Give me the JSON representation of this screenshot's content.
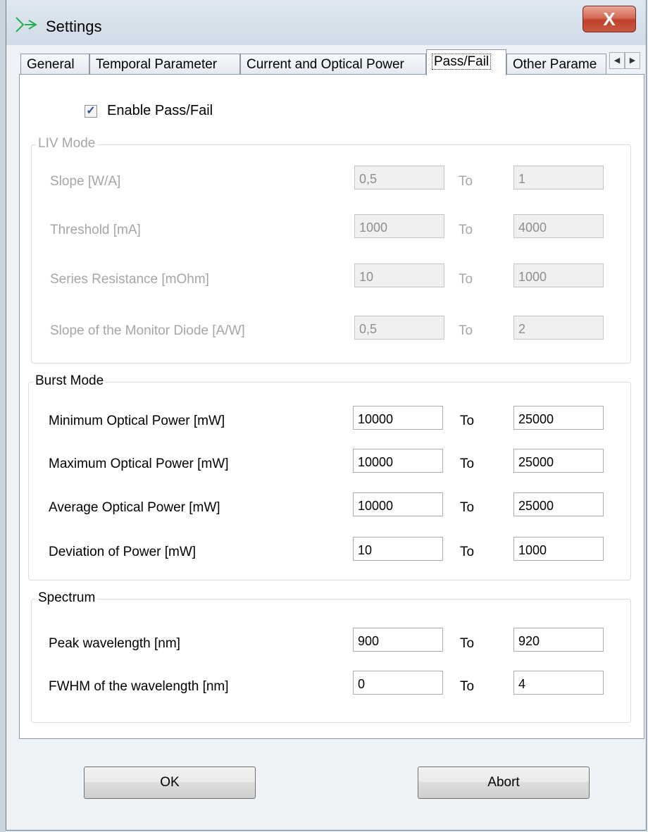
{
  "window": {
    "title": "Settings",
    "close_glyph": "X"
  },
  "icons": {
    "app": "settings-app-icon",
    "close": "close-icon",
    "scroll_left": "chevron-left-icon",
    "scroll_right": "chevron-right-icon",
    "check": "checkmark-icon"
  },
  "tabs": [
    {
      "label": "General"
    },
    {
      "label": "Temporal Parameter"
    },
    {
      "label": "Current and Optical Power"
    },
    {
      "label": "Pass/Fail",
      "active": true
    },
    {
      "label": "Other Parame"
    }
  ],
  "enable_pass_fail": {
    "label": "Enable Pass/Fail",
    "checked": true,
    "glyph": "✓"
  },
  "liv_mode": {
    "title": "LIV Mode",
    "enabled": false,
    "rows": [
      {
        "label": "Slope [W/A]",
        "from": "0,5",
        "to_label": "To",
        "to": "1"
      },
      {
        "label": "Threshold [mA]",
        "from": "1000",
        "to_label": "To",
        "to": "4000"
      },
      {
        "label": "Series Resistance [mOhm]",
        "from": "10",
        "to_label": "To",
        "to": "1000"
      },
      {
        "label": "Slope of the Monitor Diode [A/W]",
        "from": "0,5",
        "to_label": "To",
        "to": "2"
      }
    ]
  },
  "burst_mode": {
    "title": "Burst Mode",
    "rows": [
      {
        "label": "Minimum Optical Power  [mW]",
        "from": "10000",
        "to_label": "To",
        "to": "25000"
      },
      {
        "label": "Maximum Optical Power  [mW]",
        "from": "10000",
        "to_label": "To",
        "to": "25000"
      },
      {
        "label": "Average Optical Power [mW]",
        "from": "10000",
        "to_label": "To",
        "to": "25000"
      },
      {
        "label": "Deviation of Power  [mW]",
        "from": "10",
        "to_label": "To",
        "to": "1000"
      }
    ]
  },
  "spectrum": {
    "title": "Spectrum",
    "rows": [
      {
        "label": "Peak wavelength [nm]",
        "from": "900",
        "to_label": "To",
        "to": "920"
      },
      {
        "label": "FWHM of the wavelength [nm]",
        "from": "0",
        "to_label": "To",
        "to": "4"
      }
    ]
  },
  "buttons": {
    "ok": "OK",
    "abort": "Abort",
    "scroll_left_glyph": "◀",
    "scroll_right_glyph": "▶"
  }
}
